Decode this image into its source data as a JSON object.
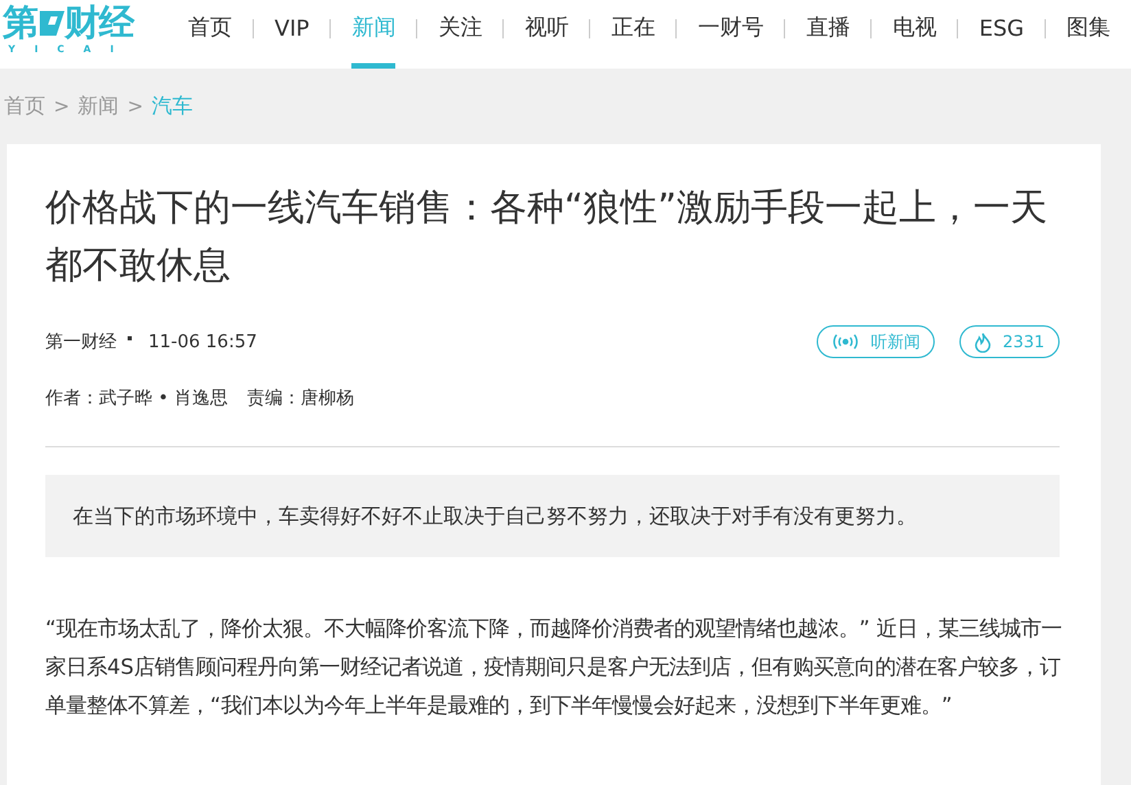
{
  "logo": {
    "text_left": "第",
    "text_right": "财经",
    "subtitle": "YICAI"
  },
  "nav": [
    {
      "label": "首页",
      "selected": false
    },
    {
      "label": "VIP",
      "selected": false
    },
    {
      "label": "新闻",
      "selected": true
    },
    {
      "label": "关注",
      "selected": false
    },
    {
      "label": "视听",
      "selected": false
    },
    {
      "label": "正在",
      "selected": false
    },
    {
      "label": "一财号",
      "selected": false
    },
    {
      "label": "直播",
      "selected": false
    },
    {
      "label": "电视",
      "selected": false
    },
    {
      "label": "ESG",
      "selected": false
    },
    {
      "label": "图集",
      "selected": false
    }
  ],
  "breadcrumb": [
    {
      "label": "首页",
      "selected": false
    },
    {
      "label": "新闻",
      "selected": false
    },
    {
      "label": "汽车",
      "selected": true
    }
  ],
  "breadcrumb_separator": ">",
  "article": {
    "title": "价格战下的一线汽车销售：各种“狼性”激励手段一起上，一天都不敢休息",
    "source": "第一财经",
    "time": "11-06 16:57",
    "listen_label": "听新闻",
    "hot_count": "2331",
    "authors": "作者：武子晔 • 肖逸思",
    "editor": "责编：唐柳杨",
    "summary": "在当下的市场环境中，车卖得好不好不止取决于自己努不努力，还取决于对手有没有更努力。",
    "paragraphs": [
      "“现在市场太乱了，降价太狠。不大幅降价客流下降，而越降价消费者的观望情绪也越浓。” 近日，某三线城市一家日系4S店销售顾问程丹向第一财经记者说道，疫情期间只是客户无法到店，但有购买意向的潜在客户较多，订单量整体不算差，“我们本以为今年上半年是最难的，到下半年慢慢会好起来，没想到下半年更难。”"
    ]
  }
}
